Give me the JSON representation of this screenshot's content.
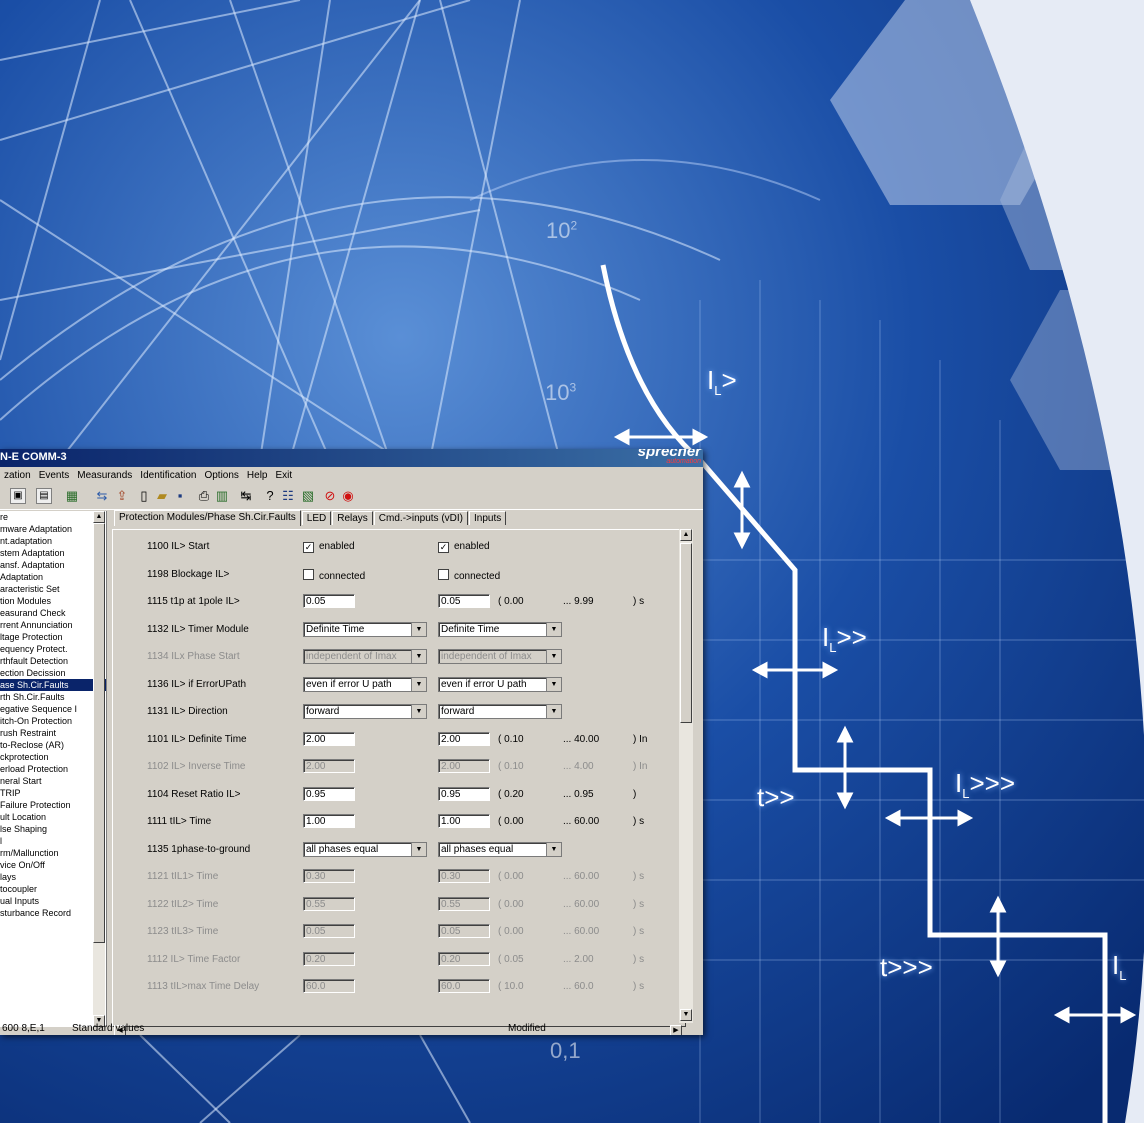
{
  "background": {
    "curve_labels": [
      "I",
      "L",
      ">",
      "I",
      "L",
      ">>",
      "t>>",
      "I",
      "L",
      ">>>",
      "t>>>",
      "I",
      "L"
    ],
    "axis_labels": [
      "10",
      "2",
      "10",
      "3",
      "0,1"
    ]
  },
  "window": {
    "title": "N-E COMM-3",
    "brand": "sprecher",
    "brand_sub": "automation"
  },
  "menu": [
    "zation",
    "Events",
    "Measurands",
    "Identification",
    "Options",
    "Help",
    "Exit"
  ],
  "toolbar": {
    "icons": [
      "view-icon",
      "window-icon",
      "chart-icon",
      "transfer-icon",
      "upload-icon",
      "new-file-icon",
      "open-icon",
      "save-icon",
      "print-icon",
      "report-icon",
      "compare-icon",
      "help-icon",
      "settings-icon",
      "device-icon",
      "stop-icon",
      "record-icon"
    ]
  },
  "tree": {
    "items": [
      "re",
      "mware Adaptation",
      "nt.adaptation",
      "stem Adaptation",
      "ansf. Adaptation",
      " Adaptation",
      "aracteristic Set",
      "tion Modules",
      "easurand Check",
      "rrent Annunciation",
      "ltage Protection",
      "equency Protect.",
      "rthfault Detection",
      "ection Decission",
      "ase Sh.Cir.Faults",
      "rth Sh.Cir.Faults",
      "egative Sequence I",
      "itch-On Protection",
      "rush Restraint",
      "to-Reclose (AR)",
      "ckprotection",
      "erload Protection",
      "neral Start",
      " TRIP",
      " Failure Protection",
      "ult Location",
      "lse Shaping",
      "l",
      "rm/Mallunction",
      "vice On/Off",
      "lays",
      "tocoupler",
      "ual Inputs",
      "sturbance Record"
    ],
    "selected_index": 14
  },
  "tabs": [
    "Protection Modules/Phase Sh.Cir.Faults",
    "LED",
    "Relays",
    "Cmd.->inputs (vDI)",
    "Inputs"
  ],
  "params": [
    {
      "id": "start",
      "label": "1100 IL> Start",
      "kind": "check",
      "v1": "enabled",
      "v2": "enabled",
      "checked": true
    },
    {
      "id": "blockage",
      "label": "1198 Blockage IL>",
      "kind": "check",
      "v1": "connected",
      "v2": "connected",
      "checked": false
    },
    {
      "id": "t1p",
      "label": "1115 t1p at 1pole IL>",
      "kind": "input",
      "v1": "0.05",
      "v2": "0.05",
      "range": "( 0.00",
      "max": "... 9.99",
      "unit": ") s"
    },
    {
      "id": "timer-module",
      "label": "1132 IL> Timer Module",
      "kind": "select",
      "v1": "Definite Time",
      "v2": "Definite Time"
    },
    {
      "id": "phase-start",
      "label": "1134 ILx Phase Start",
      "kind": "select",
      "v1": "independent of Imax",
      "v2": "independent of Imax",
      "disabled": true
    },
    {
      "id": "error-upath",
      "label": "1136 IL> if ErrorUPath",
      "kind": "select",
      "v1": "even if error U path",
      "v2": "even if error U path"
    },
    {
      "id": "direction",
      "label": "1131 IL> Direction",
      "kind": "select",
      "v1": "forward",
      "v2": "forward"
    },
    {
      "id": "definite-time",
      "label": "1101 IL> Definite Time",
      "kind": "input",
      "v1": "2.00",
      "v2": "2.00",
      "range": "( 0.10",
      "max": "... 40.00",
      "unit": ") In"
    },
    {
      "id": "inverse-time",
      "label": "1102 IL> Inverse Time",
      "kind": "input",
      "v1": "2.00",
      "v2": "2.00",
      "range": "( 0.10",
      "max": "... 4.00",
      "unit": ") In",
      "disabled": true
    },
    {
      "id": "reset-ratio",
      "label": "1104 Reset Ratio IL>",
      "kind": "input",
      "v1": "0.95",
      "v2": "0.95",
      "range": "( 0.20",
      "max": "... 0.95",
      "unit": ")"
    },
    {
      "id": "til-time",
      "label": "1111 tIL> Time",
      "kind": "input",
      "v1": "1.00",
      "v2": "1.00",
      "range": "( 0.00",
      "max": "... 60.00",
      "unit": ") s"
    },
    {
      "id": "phase-to-ground",
      "label": "1135 1phase-to-ground",
      "kind": "select",
      "v1": "all phases equal",
      "v2": "all phases equal"
    },
    {
      "id": "til1-time",
      "label": "1121 tIL1> Time",
      "kind": "input",
      "v1": "0.30",
      "v2": "0.30",
      "range": "( 0.00",
      "max": "... 60.00",
      "unit": ") s",
      "disabled": true
    },
    {
      "id": "til2-time",
      "label": "1122 tIL2> Time",
      "kind": "input",
      "v1": "0.55",
      "v2": "0.55",
      "range": "( 0.00",
      "max": "... 60.00",
      "unit": ") s",
      "disabled": true
    },
    {
      "id": "til3-time",
      "label": "1123 tIL3> Time",
      "kind": "input",
      "v1": "0.05",
      "v2": "0.05",
      "range": "( 0.00",
      "max": "... 60.00",
      "unit": ") s",
      "disabled": true
    },
    {
      "id": "time-factor",
      "label": "1112 IL> Time Factor",
      "kind": "input",
      "v1": "0.20",
      "v2": "0.20",
      "range": "( 0.05",
      "max": "... 2.00",
      "unit": ") s",
      "disabled": true
    },
    {
      "id": "max-time-delay",
      "label": "1113 tIL>max Time Delay",
      "kind": "input",
      "v1": "60.0",
      "v2": "60.0",
      "range": "( 10.0",
      "max": "... 60.0",
      "unit": ") s",
      "disabled": true
    }
  ],
  "statusbar": {
    "port": "600 8,E,1",
    "message": "Standard values",
    "state": "Modified"
  }
}
